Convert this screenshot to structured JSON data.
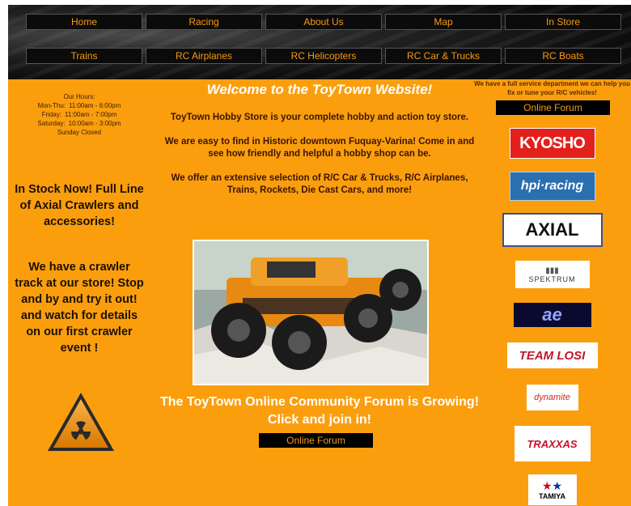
{
  "nav": {
    "row1": [
      "Home",
      "Racing",
      "About Us",
      "Map",
      "In Store"
    ],
    "row2": [
      "Trains",
      "RC Airplanes",
      "RC Helicopters",
      "RC Car & Trucks",
      "RC Boats"
    ]
  },
  "left": {
    "hours_title": "Our Hours:",
    "hours": [
      {
        "day": "Mon-Thu:",
        "time": "11:00am - 6:00pm"
      },
      {
        "day": "Friday:",
        "time": "11:00am - 7:00pm"
      },
      {
        "day": "Saturday:",
        "time": "10:00am - 3:00pm"
      }
    ],
    "sunday": "Sunday Closed",
    "stock_text": "In Stock Now! Full Line of Axial Crawlers and accessories!",
    "crawler_text": "We have a crawler track at our store! Stop and by and try it out!  and watch for details on our first crawler event !"
  },
  "center": {
    "welcome": "Welcome to the ToyTown Website!",
    "para1": "ToyTown Hobby Store is your complete hobby and action toy store.",
    "para2": "We are easy to find in Historic downtown Fuquay-Varina!  Come in and see how friendly and helpful a hobby shop can be.",
    "para3": "We offer an extensive selection of R/C Car & Trucks, R/C Airplanes, Trains, Rockets, Die Cast Cars, and more!",
    "forum_heading": "The ToyTown Online Community Forum is Growing!  Click and join in!",
    "forum_button": "Online Forum"
  },
  "right": {
    "service": "We have a full service department we can help you fix or tune your R/C vehicles!",
    "forum_button": "Online Forum",
    "logos": [
      "KYOSHO",
      "hpi·racing",
      "AXIAL",
      "SPEKTRUM",
      "ae",
      "TEAM LOSI",
      "dynamite",
      "TRAXXAS",
      "TAMIYA"
    ]
  },
  "colors": {
    "page_bg": "#fb9e0e",
    "nav_text": "#f79a14",
    "nav_bg": "#0b0b0b"
  }
}
